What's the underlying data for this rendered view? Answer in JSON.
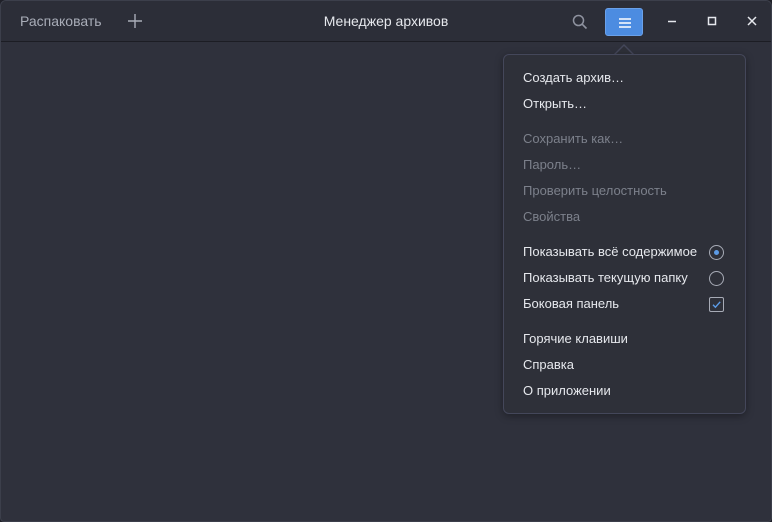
{
  "headerbar": {
    "extract_label": "Распаковать",
    "title": "Менеджер архивов"
  },
  "icons": {
    "new": "plus-icon",
    "search": "search-icon",
    "menu": "hamburger-menu-icon",
    "minimize": "minimize-icon",
    "maximize": "maximize-icon",
    "close": "close-icon"
  },
  "colors": {
    "accent": "#4c8ce1",
    "window_bg": "#2f313c",
    "headerbar_bg": "#2c2e38",
    "popover_bg": "#2e3039"
  },
  "menu": {
    "create_archive": "Создать архив…",
    "open": "Открыть…",
    "save_as": "Сохранить как…",
    "password": "Пароль…",
    "check_integrity": "Проверить целостность",
    "properties": "Свойства",
    "show_all": "Показывать всё содержимое",
    "show_folder": "Показывать текущую папку",
    "sidebar": "Боковая панель",
    "shortcuts": "Горячие клавиши",
    "help": "Справка",
    "about": "О приложении"
  },
  "state": {
    "view_mode": "show_all",
    "sidebar_enabled": true
  }
}
